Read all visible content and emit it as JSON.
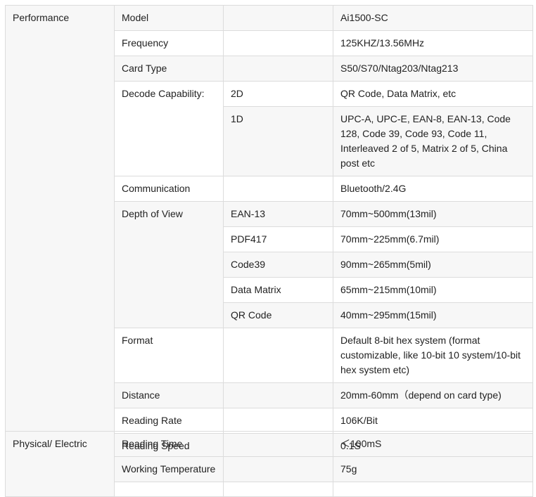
{
  "groups": {
    "performance": "Performance",
    "physical": "Physical/ Electric"
  },
  "rows": {
    "model": {
      "label": "Model",
      "value": "Ai1500-SC"
    },
    "frequency": {
      "label": "Frequency",
      "value": "125KHZ/13.56MHz"
    },
    "card_type": {
      "label": "Card Type",
      "value": "S50/S70/Ntag203/Ntag213"
    },
    "decode": {
      "label": "Decode Capability:",
      "d2": {
        "sub": "2D",
        "value": "QR Code, Data Matrix, etc"
      },
      "d1": {
        "sub": "1D",
        "value": "UPC-A, UPC-E, EAN-8, EAN-13, Code 128, Code 39, Code 93, Code 11, Interleaved 2 of 5, Matrix 2 of 5, China post etc"
      }
    },
    "communication": {
      "label": "Communication",
      "value": "Bluetooth/2.4G"
    },
    "depth": {
      "label": "Depth of View",
      "items": [
        {
          "sub": "EAN-13",
          "value": "70mm~500mm(13mil)"
        },
        {
          "sub": "PDF417",
          "value": "70mm~225mm(6.7mil)"
        },
        {
          "sub": "Code39",
          "value": "90mm~265mm(5mil)"
        },
        {
          "sub": "Data Matrix",
          "value": "65mm~215mm(10mil)"
        },
        {
          "sub": "QR Code",
          "value": "40mm~295mm(15mil)"
        }
      ]
    },
    "format": {
      "label": "Format",
      "value": "Default 8-bit hex system (format customizable, like 10-bit 10 system/10-bit hex system etc)"
    },
    "distance": {
      "label": "Distance",
      "value": "20mm-60mm（depend on card type)"
    },
    "reading_rate": {
      "label": "Reading Rate",
      "value": "106K/Bit"
    },
    "reading_speed": {
      "label": "Reading Speed",
      "value": "0.1S"
    },
    "reading_time": {
      "label": "Reading Time",
      "value": "＜100mS"
    },
    "working_temp": {
      "label": "Working Temperature",
      "value": "75g"
    }
  }
}
